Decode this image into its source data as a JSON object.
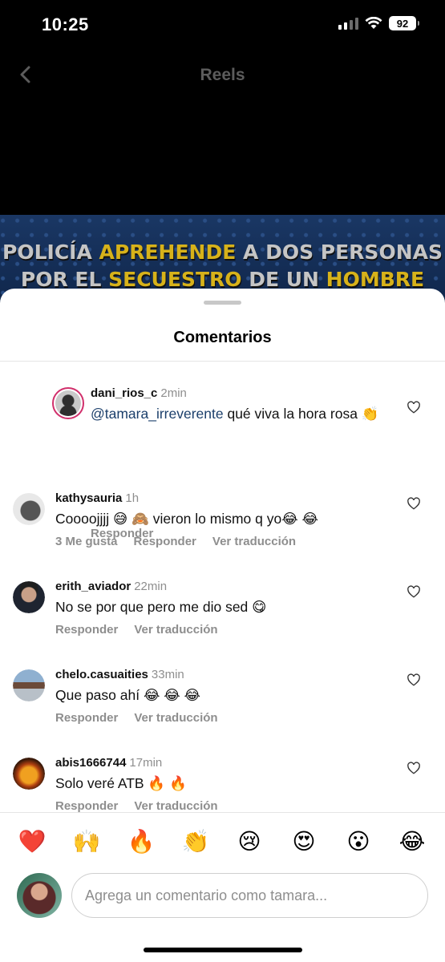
{
  "status_bar": {
    "time": "10:25",
    "battery": "92"
  },
  "header": {
    "title": "Reels"
  },
  "video": {
    "headline": [
      [
        {
          "t": "POLICÍA ",
          "hl": false
        },
        {
          "t": "APREHENDE",
          "hl": true
        },
        {
          "t": " A DOS PERSONAS",
          "hl": false
        }
      ],
      [
        {
          "t": "POR EL ",
          "hl": false
        },
        {
          "t": "SECUESTRO",
          "hl": true
        },
        {
          "t": " DE UN ",
          "hl": false
        },
        {
          "t": "HOMBRE",
          "hl": true
        }
      ]
    ]
  },
  "sheet": {
    "title": "Comentarios",
    "comments": [
      {
        "user": "dani_rios_c",
        "time": "2min",
        "mention": "@tamara_irreverente",
        "text": " qué viva la hora rosa 👏",
        "actions": [
          "Responder"
        ],
        "reply": true,
        "avatar_colors": [
          "#c9c9c9",
          "#2f2f2f"
        ]
      },
      {
        "user": "kathysauria",
        "time": "1h",
        "text": "Cooooјjjj 😅 🙈 vieron lo mismo q yo😂 😂",
        "actions": [
          "3 Me gusta",
          "Responder",
          "Ver traducción"
        ],
        "reply": false,
        "avatar_colors": [
          "#e8e8e8",
          "#555555"
        ]
      },
      {
        "user": "erith_aviador",
        "time": "22min",
        "text": "No se por que pero me dio sed 😋",
        "actions": [
          "Responder",
          "Ver traducción"
        ],
        "reply": false,
        "avatar_colors": [
          "#c8a088",
          "#1e2430"
        ]
      },
      {
        "user": "chelo.casuaities",
        "time": "33min",
        "text": "Que paso ahí 😂 😂 😂",
        "actions": [
          "Responder",
          "Ver traducción"
        ],
        "reply": false,
        "avatar_colors": [
          "#8fb0d0",
          "#6b4b3a"
        ]
      },
      {
        "user": "abis1666744",
        "time": "17min",
        "text": "Solo veré ATB 🔥 🔥",
        "actions": [
          "Responder",
          "Ver traducción"
        ],
        "reply": false,
        "avatar_colors": [
          "#f0a020",
          "#3a1a0a"
        ]
      }
    ]
  },
  "emoji_bar": [
    "❤️",
    "🙌",
    "🔥",
    "👏",
    "😢",
    "😍",
    "😮",
    "😂"
  ],
  "input": {
    "placeholder": "Agrega un comentario como tamara..."
  },
  "colors": {
    "accent_link": "#1b3f6b",
    "secondary_text": "#8e8e8e",
    "headline_highlight": "#d7b21a"
  }
}
